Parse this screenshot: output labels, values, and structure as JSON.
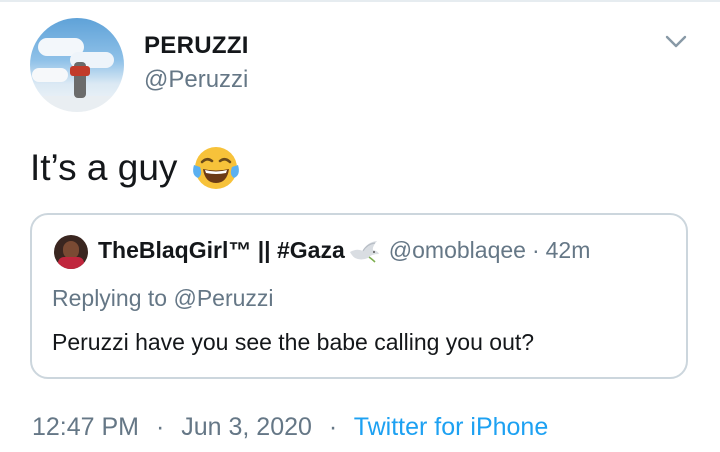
{
  "tweet": {
    "display_name": "PERUZZI",
    "handle": "@Peruzzi",
    "text": "It’s a guy",
    "emoji_icon": "face-with-tears-of-joy-icon"
  },
  "quoted_tweet": {
    "display_name": "TheBlaqGirl™ || #Gaza",
    "name_emoji_icon": "dove-icon",
    "handle": "@omoblaqee",
    "separator": "·",
    "time": "42m",
    "replying_prefix": "Replying to",
    "replying_to": "@Peruzzi",
    "body": "Peruzzi have you see the babe calling you out?"
  },
  "meta": {
    "time": "12:47 PM",
    "separator1": "·",
    "date": "Jun 3, 2020",
    "separator2": "·",
    "source": "Twitter for iPhone"
  },
  "colors": {
    "text": "#14171a",
    "secondary": "#657786",
    "link": "#1da1f2",
    "border": "#ccd6dd"
  }
}
